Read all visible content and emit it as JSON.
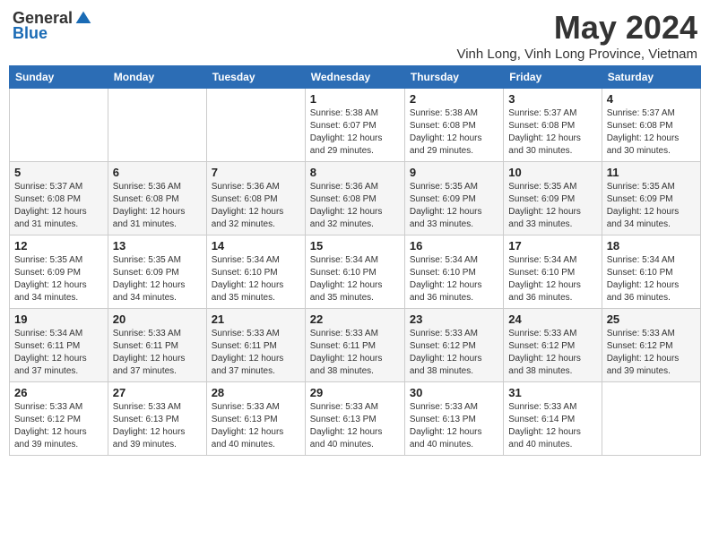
{
  "logo": {
    "general": "General",
    "blue": "Blue"
  },
  "title": {
    "month": "May 2024",
    "location": "Vinh Long, Vinh Long Province, Vietnam"
  },
  "headers": [
    "Sunday",
    "Monday",
    "Tuesday",
    "Wednesday",
    "Thursday",
    "Friday",
    "Saturday"
  ],
  "weeks": [
    {
      "days": [
        {
          "num": "",
          "info": ""
        },
        {
          "num": "",
          "info": ""
        },
        {
          "num": "",
          "info": ""
        },
        {
          "num": "1",
          "info": "Sunrise: 5:38 AM\nSunset: 6:07 PM\nDaylight: 12 hours\nand 29 minutes."
        },
        {
          "num": "2",
          "info": "Sunrise: 5:38 AM\nSunset: 6:08 PM\nDaylight: 12 hours\nand 29 minutes."
        },
        {
          "num": "3",
          "info": "Sunrise: 5:37 AM\nSunset: 6:08 PM\nDaylight: 12 hours\nand 30 minutes."
        },
        {
          "num": "4",
          "info": "Sunrise: 5:37 AM\nSunset: 6:08 PM\nDaylight: 12 hours\nand 30 minutes."
        }
      ]
    },
    {
      "days": [
        {
          "num": "5",
          "info": "Sunrise: 5:37 AM\nSunset: 6:08 PM\nDaylight: 12 hours\nand 31 minutes."
        },
        {
          "num": "6",
          "info": "Sunrise: 5:36 AM\nSunset: 6:08 PM\nDaylight: 12 hours\nand 31 minutes."
        },
        {
          "num": "7",
          "info": "Sunrise: 5:36 AM\nSunset: 6:08 PM\nDaylight: 12 hours\nand 32 minutes."
        },
        {
          "num": "8",
          "info": "Sunrise: 5:36 AM\nSunset: 6:08 PM\nDaylight: 12 hours\nand 32 minutes."
        },
        {
          "num": "9",
          "info": "Sunrise: 5:35 AM\nSunset: 6:09 PM\nDaylight: 12 hours\nand 33 minutes."
        },
        {
          "num": "10",
          "info": "Sunrise: 5:35 AM\nSunset: 6:09 PM\nDaylight: 12 hours\nand 33 minutes."
        },
        {
          "num": "11",
          "info": "Sunrise: 5:35 AM\nSunset: 6:09 PM\nDaylight: 12 hours\nand 34 minutes."
        }
      ]
    },
    {
      "days": [
        {
          "num": "12",
          "info": "Sunrise: 5:35 AM\nSunset: 6:09 PM\nDaylight: 12 hours\nand 34 minutes."
        },
        {
          "num": "13",
          "info": "Sunrise: 5:35 AM\nSunset: 6:09 PM\nDaylight: 12 hours\nand 34 minutes."
        },
        {
          "num": "14",
          "info": "Sunrise: 5:34 AM\nSunset: 6:10 PM\nDaylight: 12 hours\nand 35 minutes."
        },
        {
          "num": "15",
          "info": "Sunrise: 5:34 AM\nSunset: 6:10 PM\nDaylight: 12 hours\nand 35 minutes."
        },
        {
          "num": "16",
          "info": "Sunrise: 5:34 AM\nSunset: 6:10 PM\nDaylight: 12 hours\nand 36 minutes."
        },
        {
          "num": "17",
          "info": "Sunrise: 5:34 AM\nSunset: 6:10 PM\nDaylight: 12 hours\nand 36 minutes."
        },
        {
          "num": "18",
          "info": "Sunrise: 5:34 AM\nSunset: 6:10 PM\nDaylight: 12 hours\nand 36 minutes."
        }
      ]
    },
    {
      "days": [
        {
          "num": "19",
          "info": "Sunrise: 5:34 AM\nSunset: 6:11 PM\nDaylight: 12 hours\nand 37 minutes."
        },
        {
          "num": "20",
          "info": "Sunrise: 5:33 AM\nSunset: 6:11 PM\nDaylight: 12 hours\nand 37 minutes."
        },
        {
          "num": "21",
          "info": "Sunrise: 5:33 AM\nSunset: 6:11 PM\nDaylight: 12 hours\nand 37 minutes."
        },
        {
          "num": "22",
          "info": "Sunrise: 5:33 AM\nSunset: 6:11 PM\nDaylight: 12 hours\nand 38 minutes."
        },
        {
          "num": "23",
          "info": "Sunrise: 5:33 AM\nSunset: 6:12 PM\nDaylight: 12 hours\nand 38 minutes."
        },
        {
          "num": "24",
          "info": "Sunrise: 5:33 AM\nSunset: 6:12 PM\nDaylight: 12 hours\nand 38 minutes."
        },
        {
          "num": "25",
          "info": "Sunrise: 5:33 AM\nSunset: 6:12 PM\nDaylight: 12 hours\nand 39 minutes."
        }
      ]
    },
    {
      "days": [
        {
          "num": "26",
          "info": "Sunrise: 5:33 AM\nSunset: 6:12 PM\nDaylight: 12 hours\nand 39 minutes."
        },
        {
          "num": "27",
          "info": "Sunrise: 5:33 AM\nSunset: 6:13 PM\nDaylight: 12 hours\nand 39 minutes."
        },
        {
          "num": "28",
          "info": "Sunrise: 5:33 AM\nSunset: 6:13 PM\nDaylight: 12 hours\nand 40 minutes."
        },
        {
          "num": "29",
          "info": "Sunrise: 5:33 AM\nSunset: 6:13 PM\nDaylight: 12 hours\nand 40 minutes."
        },
        {
          "num": "30",
          "info": "Sunrise: 5:33 AM\nSunset: 6:13 PM\nDaylight: 12 hours\nand 40 minutes."
        },
        {
          "num": "31",
          "info": "Sunrise: 5:33 AM\nSunset: 6:14 PM\nDaylight: 12 hours\nand 40 minutes."
        },
        {
          "num": "",
          "info": ""
        }
      ]
    }
  ]
}
